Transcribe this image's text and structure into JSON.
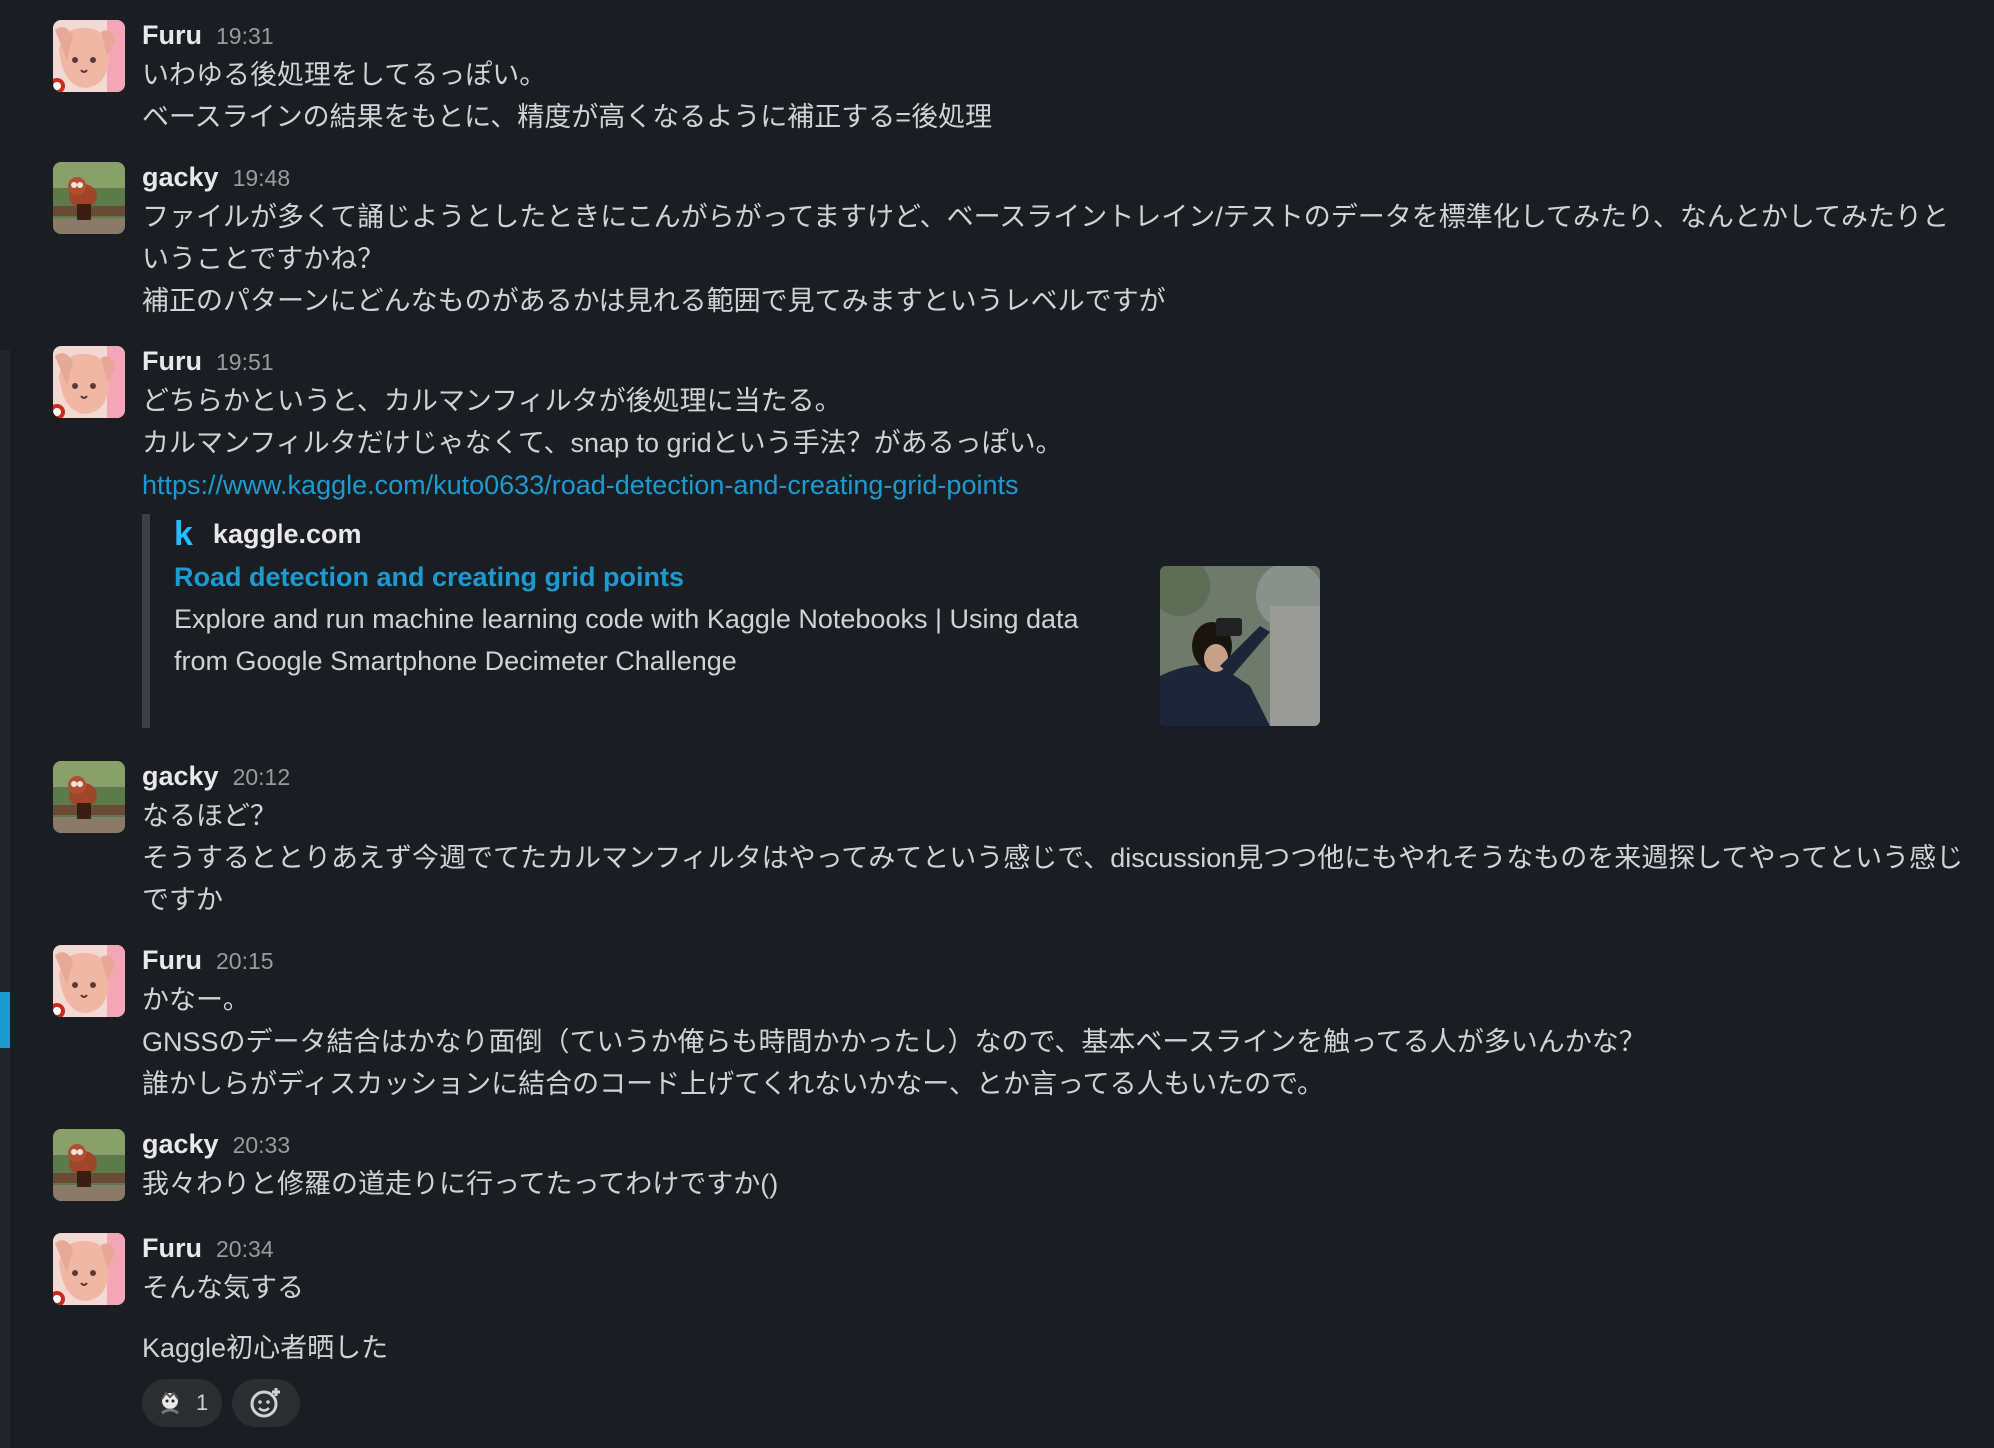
{
  "messages": [
    {
      "author": "Furu",
      "time": "19:31",
      "avatar": "anime-dog-avatar",
      "lines": [
        "いわゆる後処理をしてるっぽい。",
        "ベースラインの結果をもとに、精度が高くなるように補正する=後処理"
      ]
    },
    {
      "author": "gacky",
      "time": "19:48",
      "avatar": "red-panda-avatar",
      "lines": [
        "ファイルが多くて誦じようとしたときにこんがらがってますけど、ベースライントレイン/テストのデータを標準化してみたり、なんとかしてみたりということですかね？",
        "補正のパターンにどんなものがあるかは見れる範囲で見てみますというレベルですが"
      ]
    },
    {
      "author": "Furu",
      "time": "19:51",
      "avatar": "anime-dog-avatar",
      "lines": [
        "どちらかというと、カルマンフィルタが後処理に当たる。",
        "カルマンフィルタだけじゃなくて、snap to gridという手法？があるっぽい。"
      ],
      "link": "https://www.kaggle.com/kuto0633/road-detection-and-creating-grid-points",
      "unfurl": {
        "site_icon": "k",
        "site": "kaggle.com",
        "title": "Road detection and creating grid points",
        "description": "Explore and run machine learning code with Kaggle Notebooks | Using data from Google Smartphone Decimeter Challenge",
        "thumbnail": "person-with-camera-photo"
      }
    },
    {
      "author": "gacky",
      "time": "20:12",
      "avatar": "red-panda-avatar",
      "lines": [
        "なるほど？",
        "そうするととりあえず今週でてたカルマンフィルタはやってみてという感じで、discussion見つつ他にもやれそうなものを来週探してやってという感じですか"
      ]
    },
    {
      "author": "Furu",
      "time": "20:15",
      "avatar": "anime-dog-avatar",
      "lines": [
        "かなー。",
        "GNSSのデータ結合はかなり面倒（ていうか俺らも時間かかったし）なので、基本ベースラインを触ってる人が多いんかな？",
        "誰かしらがディスカッションに結合のコード上げてくれないかなー、とか言ってる人もいたので。"
      ]
    },
    {
      "author": "gacky",
      "time": "20:33",
      "avatar": "red-panda-avatar",
      "lines": [
        "我々わりと修羅の道走りに行ってたってわけですか()"
      ]
    },
    {
      "author": "Furu",
      "time": "20:34",
      "avatar": "anime-dog-avatar",
      "lines": [
        "そんな気する"
      ],
      "followup": "Kaggle初心者晒した",
      "reactions": [
        {
          "emoji": "custom-emoji-icon",
          "count": "1"
        }
      ]
    }
  ],
  "colors": {
    "background": "#1a1d21",
    "link": "#1d9bd1",
    "text": "#d1d2d3",
    "muted": "#9a9b9d"
  }
}
